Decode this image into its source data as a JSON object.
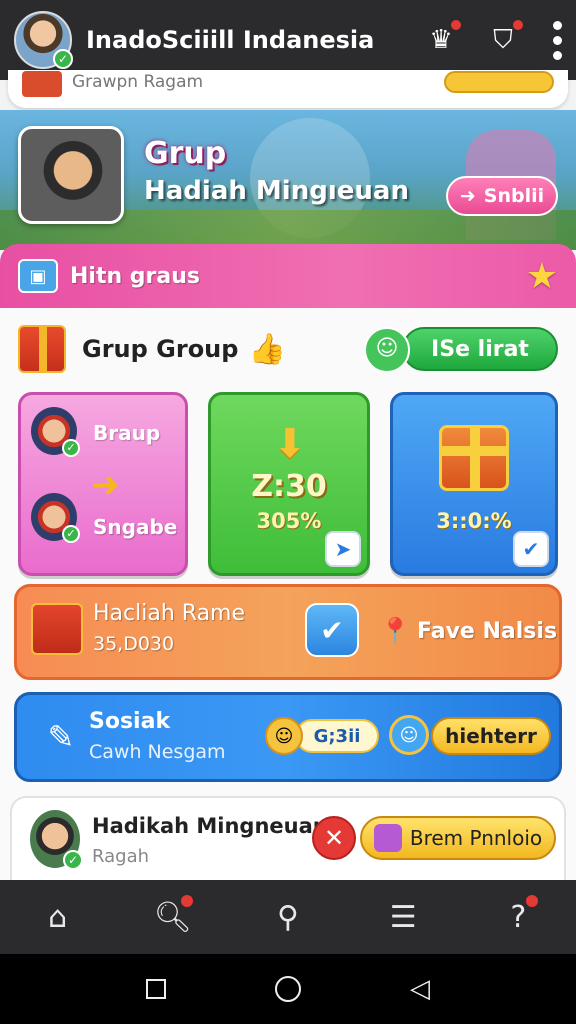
{
  "header": {
    "title": "InadoSciiill Indanesia",
    "icons": [
      "profile-avatar",
      "crown-bell-icon",
      "bag-icon",
      "more-icon"
    ]
  },
  "strip": {
    "text": "Grawpn Ragam"
  },
  "hero": {
    "title": "Grup",
    "subtitle": "Hadiah Mingıeuan",
    "button": "Snblii"
  },
  "pinkbar": {
    "label": "Hitn graus"
  },
  "group": {
    "title": "Grup Group",
    "see_button": "ISe lirat"
  },
  "tiles": {
    "t1": {
      "top_label": "Braup",
      "bottom_label": "Sngabe"
    },
    "t2": {
      "big": "Z:30",
      "small": "305%"
    },
    "t3": {
      "small": "3::0:%"
    }
  },
  "orange_card": {
    "title": "Hacliah Rame",
    "amount": "35,D030",
    "fav": "Fave Nalsis"
  },
  "blue_card": {
    "title": "Sosiak",
    "subtitle": "Cawh Nesgam",
    "pill1": "G;3ii",
    "pill2": "hiehterr"
  },
  "white_card": {
    "title": "Hadikah Mingneuan",
    "subtitle": "Ragah",
    "pill": "Brem Pnnloio"
  },
  "bottom_nav": [
    "home",
    "search",
    "profile",
    "list",
    "help"
  ],
  "colors": {
    "topbar": "#2b2b2e",
    "pink": "#e84fa3",
    "green": "#3fbd39",
    "blue": "#2a7be0",
    "orange": "#f4a35a",
    "yellow": "#f4b821"
  }
}
